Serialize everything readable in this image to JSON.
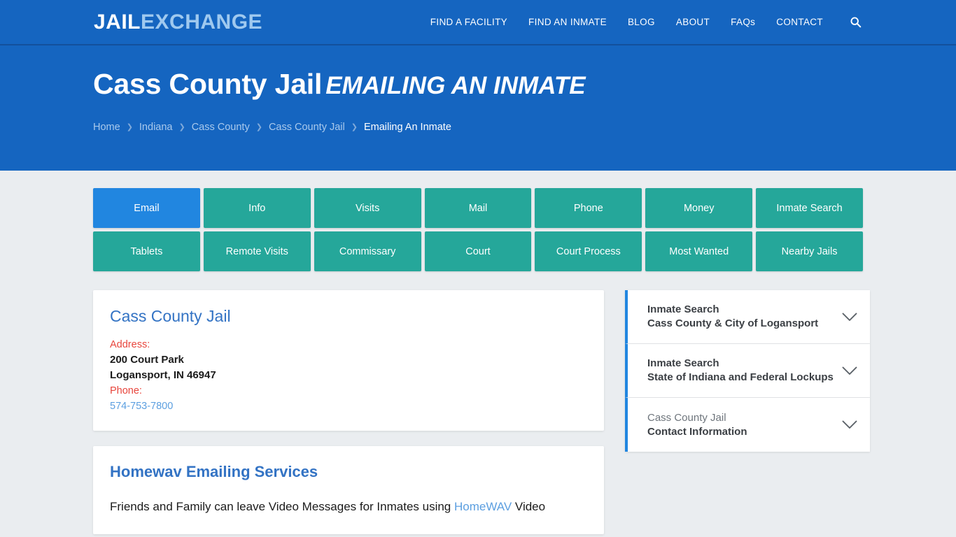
{
  "header": {
    "logo": {
      "part1": "JAIL",
      "part2": "EXCHANGE"
    },
    "nav": [
      {
        "label": "FIND A FACILITY"
      },
      {
        "label": "FIND AN INMATE"
      },
      {
        "label": "BLOG"
      },
      {
        "label": "ABOUT"
      },
      {
        "label": "FAQs"
      },
      {
        "label": "CONTACT"
      }
    ],
    "search_icon": "search-icon"
  },
  "hero": {
    "title": "Cass County Jail",
    "subject": "EMAILING AN INMATE",
    "breadcrumb": [
      {
        "label": "Home",
        "current": false
      },
      {
        "label": "Indiana",
        "current": false
      },
      {
        "label": "Cass County",
        "current": false
      },
      {
        "label": "Cass County Jail",
        "current": false
      },
      {
        "label": "Emailing An Inmate",
        "current": true
      }
    ],
    "breadcrumb_separator": "❯"
  },
  "tabs": [
    {
      "label": "Email",
      "active": true
    },
    {
      "label": "Info",
      "active": false
    },
    {
      "label": "Visits",
      "active": false
    },
    {
      "label": "Mail",
      "active": false
    },
    {
      "label": "Phone",
      "active": false
    },
    {
      "label": "Money",
      "active": false
    },
    {
      "label": "Inmate Search",
      "active": false
    },
    {
      "label": "Tablets",
      "active": false
    },
    {
      "label": "Remote Visits",
      "active": false
    },
    {
      "label": "Commissary",
      "active": false
    },
    {
      "label": "Court",
      "active": false
    },
    {
      "label": "Court Process",
      "active": false
    },
    {
      "label": "Most Wanted",
      "active": false
    },
    {
      "label": "Nearby Jails",
      "active": false
    }
  ],
  "facility_card": {
    "name": "Cass County Jail",
    "address_label": "Address:",
    "address_line1": "200 Court Park",
    "address_line2": "Logansport, IN 46947",
    "phone_label": "Phone:",
    "phone": "574-753-7800"
  },
  "article": {
    "title": "Homewav Emailing Services",
    "paragraph_before": "Friends and Family can leave Video Messages for Inmates using ",
    "paragraph_link": "HomeWAV",
    "paragraph_after": " Video"
  },
  "sidebar": {
    "items": [
      {
        "line1": "Inmate Search",
        "line2": "Cass County & City of Logansport",
        "line1_muted": false
      },
      {
        "line1": "Inmate Search",
        "line2": "State of Indiana and Federal Lockups",
        "line1_muted": false
      },
      {
        "line1": "Cass County Jail",
        "line2": "Contact Information",
        "line1_muted": true
      }
    ]
  },
  "colors": {
    "header_blue": "#1565c0",
    "accent_blue": "#2186e0",
    "teal": "#25a79a",
    "link_blue": "#3373c4",
    "red_label": "#e8453c",
    "page_bg": "#eaedf0"
  }
}
